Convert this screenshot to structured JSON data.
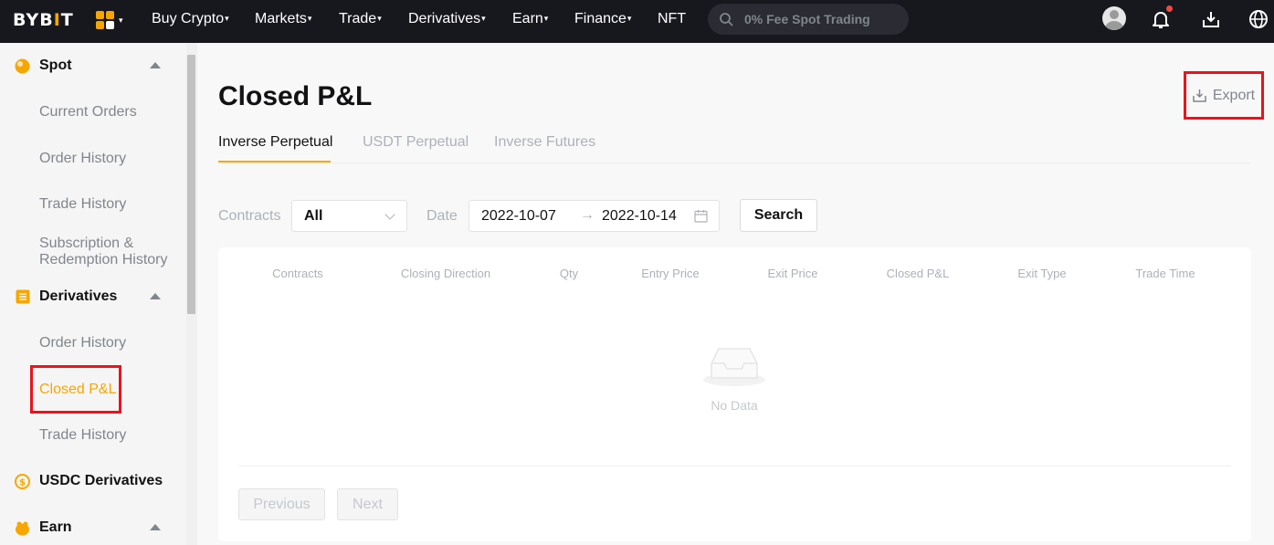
{
  "nav": {
    "logo_left": "BYB",
    "logo_bar": "I",
    "logo_right": "T",
    "items": [
      {
        "label": "Buy Crypto",
        "caret": "▾"
      },
      {
        "label": "Markets",
        "caret": "▾"
      },
      {
        "label": "Trade",
        "caret": "▾"
      },
      {
        "label": "Derivatives",
        "caret": "▾"
      },
      {
        "label": "Earn",
        "caret": "▾"
      },
      {
        "label": "Finance",
        "caret": "▾"
      },
      {
        "label": "NFT",
        "caret": ""
      }
    ],
    "apps_caret": "▾",
    "search_placeholder": "0% Fee Spot Trading",
    "icons": [
      "avatar",
      "bell-icon",
      "download-icon",
      "globe-icon"
    ]
  },
  "sidebar": {
    "spot": {
      "label": "Spot",
      "items": [
        "Current Orders",
        "Order History",
        "Trade History",
        "Subscription &",
        "Redemption History"
      ]
    },
    "derivatives": {
      "label": "Derivatives",
      "items": [
        "Order History",
        "Closed P&L",
        "Trade History"
      ]
    },
    "usdc": {
      "label": "USDC Derivatives"
    },
    "earn": {
      "label": "Earn"
    }
  },
  "page": {
    "title": "Closed P&L",
    "export_label": "Export",
    "tabs": [
      "Inverse Perpetual",
      "USDT Perpetual",
      "Inverse Futures"
    ],
    "active_tab": "Inverse Perpetual"
  },
  "filters": {
    "contracts_label": "Contracts",
    "contracts_value": "All",
    "date_label": "Date",
    "date_from": "2022-10-07",
    "date_arrow": "→",
    "date_to": "2022-10-14",
    "search_label": "Search"
  },
  "table": {
    "columns": [
      "Contracts",
      "Closing Direction",
      "Qty",
      "Entry Price",
      "Exit Price",
      "Closed P&L",
      "Exit Type",
      "Trade Time"
    ],
    "empty_text": "No Data"
  },
  "pagination": {
    "previous": "Previous",
    "next": "Next"
  },
  "colors": {
    "accent": "#f7a600",
    "highlight": "#e8141c",
    "nav_bg": "#17181e"
  }
}
